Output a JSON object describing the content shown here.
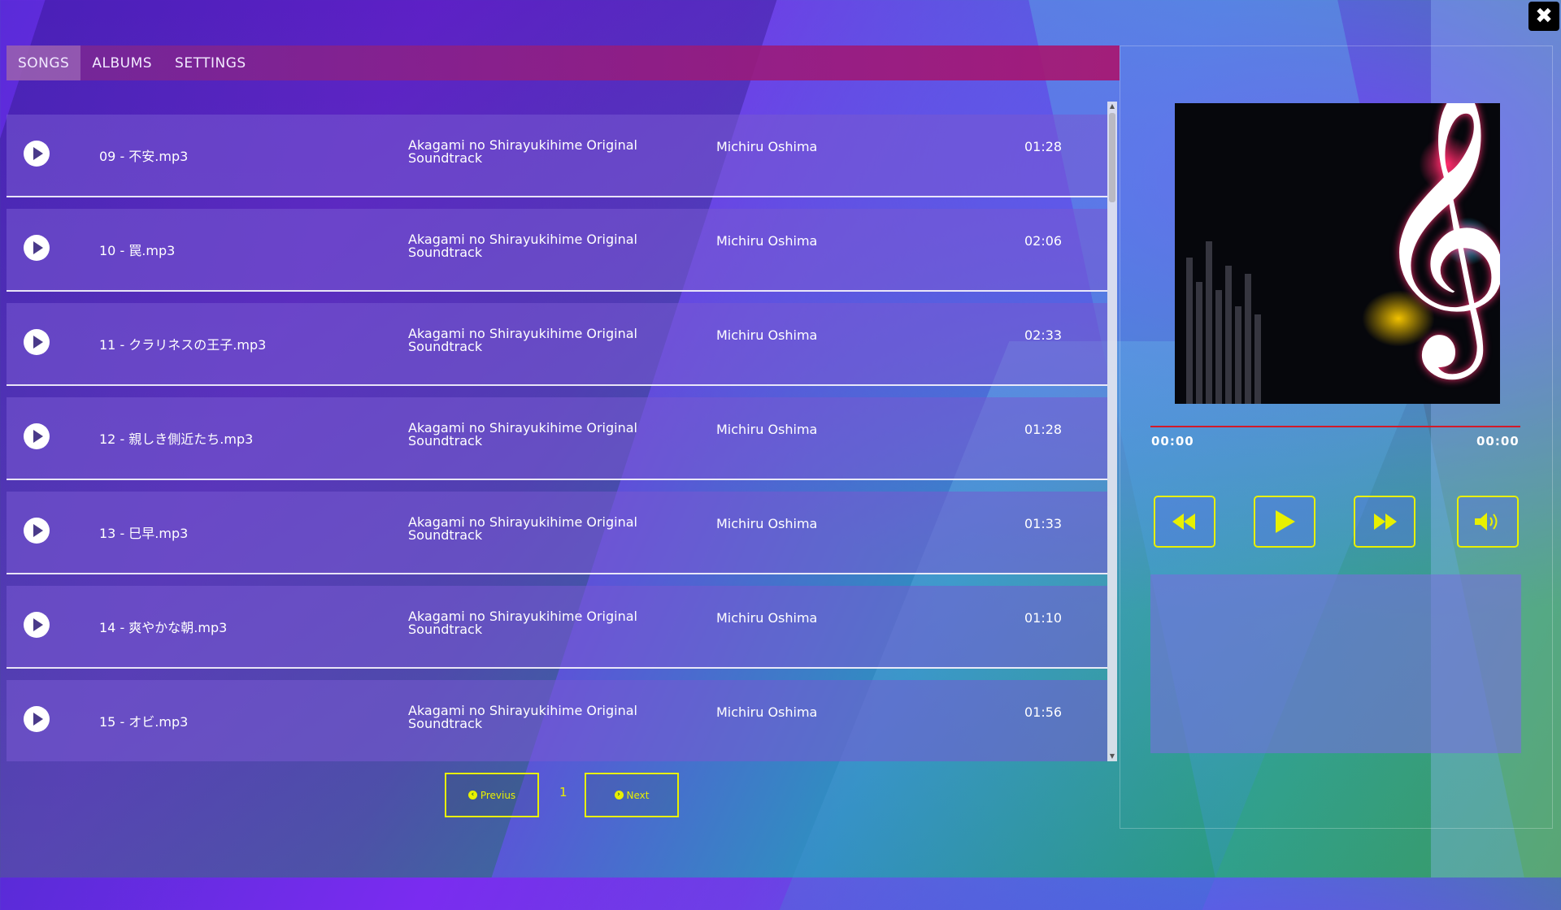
{
  "window": {
    "close_icon": "close-icon"
  },
  "tabs": [
    {
      "label": "SONGS",
      "active": true
    },
    {
      "label": "ALBUMS",
      "active": false
    },
    {
      "label": "SETTINGS",
      "active": false
    }
  ],
  "songs": [
    {
      "title": "09 - 不安.mp3",
      "album": "Akagami no Shirayukihime Original Soundtrack",
      "artist": "Michiru Oshima",
      "duration": "01:28"
    },
    {
      "title": "10 - 罠.mp3",
      "album": "Akagami no Shirayukihime Original Soundtrack",
      "artist": "Michiru Oshima",
      "duration": "02:06"
    },
    {
      "title": "11 - クラリネスの王子.mp3",
      "album": "Akagami no Shirayukihime Original Soundtrack",
      "artist": "Michiru Oshima",
      "duration": "02:33"
    },
    {
      "title": "12 - 親しき側近たち.mp3",
      "album": "Akagami no Shirayukihime Original Soundtrack",
      "artist": "Michiru Oshima",
      "duration": "01:28"
    },
    {
      "title": "13 - 巳早.mp3",
      "album": "Akagami no Shirayukihime Original Soundtrack",
      "artist": "Michiru Oshima",
      "duration": "01:33"
    },
    {
      "title": "14 - 爽やかな朝.mp3",
      "album": "Akagami no Shirayukihime Original Soundtrack",
      "artist": "Michiru Oshima",
      "duration": "01:10"
    },
    {
      "title": "15 - オビ.mp3",
      "album": "Akagami no Shirayukihime Original Soundtrack",
      "artist": "Michiru Oshima",
      "duration": "01:56"
    }
  ],
  "pagination": {
    "previous_label": "Previus",
    "next_label": "Next",
    "current_page": "1"
  },
  "player": {
    "time_current": "00:00",
    "time_total": "00:00",
    "progress_fraction": 0,
    "controls": [
      "rewind-icon",
      "play-icon",
      "fast-forward-icon",
      "volume-icon"
    ]
  },
  "colors": {
    "accent": "#e8f000",
    "progress": "#d21a2a",
    "tabbar": "#a01c7a"
  }
}
